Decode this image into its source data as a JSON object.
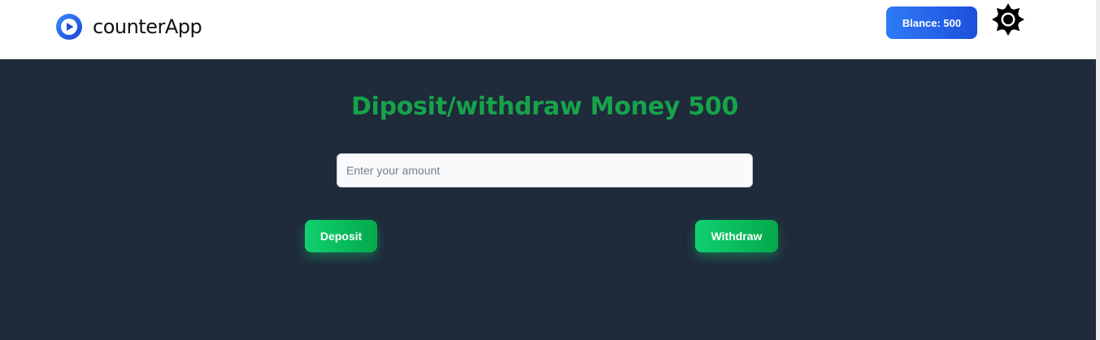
{
  "colors": {
    "navbar_bg": "#ffffff",
    "main_bg": "#1f2a3b",
    "title": "#16a34a",
    "balance_btn": "#1d4fdc",
    "action_btn": "#03a94a"
  },
  "navbar": {
    "logo_icon": "play-circle-icon",
    "brand": "counterApp",
    "balance_label": "Blance: 500",
    "theme_icon": "sun-icon"
  },
  "main": {
    "title": "Diposit/withdraw Money 500",
    "amount_input": {
      "placeholder": "Enter your amount",
      "value": ""
    },
    "deposit_label": "Deposit",
    "withdraw_label": "Withdraw"
  }
}
